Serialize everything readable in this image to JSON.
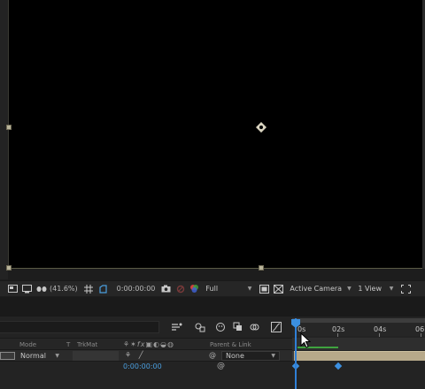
{
  "viewer_toolbar": {
    "zoom": "(41.6%)",
    "timecode": "0:00:00:00",
    "resolution": "Full",
    "view": "Active Camera",
    "layout": "1 View"
  },
  "timeline": {
    "ruler_labels": [
      "0s",
      "02s",
      "04s",
      "06"
    ],
    "headers": {
      "mode": "Mode",
      "t": "T",
      "trkmat": "TrkMat",
      "parent_link": "Parent & Link"
    },
    "layer": {
      "mode": "Normal",
      "parent": "None"
    },
    "property_time": "0:00:00:00"
  },
  "colors": {
    "accent": "#3b8fe0",
    "layer_bar": "#b7a98a",
    "work_area_line": "#3fa33f"
  }
}
